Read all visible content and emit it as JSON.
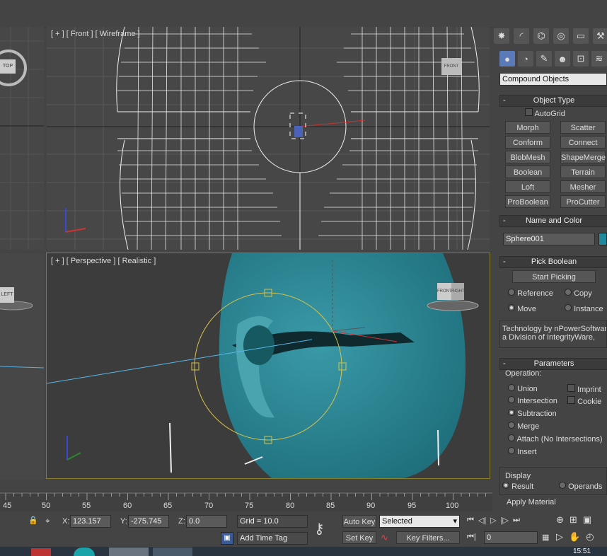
{
  "viewports": {
    "front_label": "[ + ] [ Front ] [ Wireframe ]",
    "perspective_label": "[ + ] [ Perspective ] [ Realistic ]",
    "top_cube_label": "TOP",
    "front_cube_label": "FRONT",
    "left_cube_label": "LEFT",
    "persp_cube_left": "FRONT",
    "persp_cube_right": "RIGHT"
  },
  "command_panel": {
    "category_select": "Compound Objects",
    "object_type": {
      "title": "Object Type",
      "autogrid": "AutoGrid",
      "buttons": [
        "Morph",
        "Scatter",
        "Conform",
        "Connect",
        "BlobMesh",
        "ShapeMerge",
        "Boolean",
        "Terrain",
        "Loft",
        "Mesher",
        "ProBoolean",
        "ProCutter"
      ]
    },
    "name_color": {
      "title": "Name and Color",
      "name_value": "Sphere001",
      "color": "#1e8a9c"
    },
    "pick_boolean": {
      "title": "Pick Boolean",
      "start_picking": "Start Picking",
      "options": [
        "Reference",
        "Copy",
        "Move",
        "Instance"
      ],
      "selected": "Move",
      "credit_line1": "Technology by nPowerSoftware",
      "credit_line2": "a Division of IntegrityWare,"
    },
    "parameters": {
      "title": "Parameters",
      "operation_label": "Operation:",
      "operations": [
        "Union",
        "Intersection",
        "Subtraction",
        "Merge",
        "Attach (No Intersections)",
        "Insert"
      ],
      "selected_operation": "Subtraction",
      "checks": [
        "Imprint",
        "Cookie"
      ],
      "display_label": "Display",
      "display_options": [
        "Result",
        "Operands"
      ],
      "display_selected": "Result",
      "apply_material": "Apply Material"
    }
  },
  "timeline": {
    "ticks": [
      "45",
      "50",
      "55",
      "60",
      "65",
      "70",
      "75",
      "80",
      "85",
      "90",
      "95",
      "100"
    ]
  },
  "status": {
    "x_label": "X:",
    "x_value": "123.157",
    "y_label": "Y:",
    "y_value": "-275.745",
    "z_label": "Z:",
    "z_value": "0.0",
    "grid": "Grid = 10.0",
    "add_time_tag": "Add Time Tag",
    "auto_key": "Auto Key",
    "set_key": "Set Key",
    "selected_dropdown": "Selected",
    "key_filters": "Key Filters...",
    "frame_value": "0",
    "clock": "15:51"
  }
}
